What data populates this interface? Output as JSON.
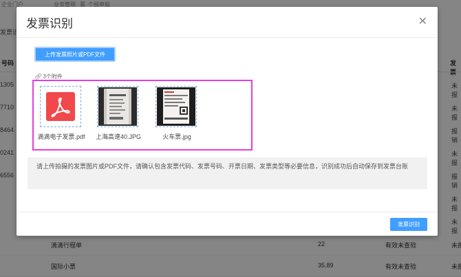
{
  "background": {
    "topnav": [
      "企业门户",
      "业务管理",
      "票",
      "个税申报"
    ],
    "sub_tab": "发票识别",
    "col_left_header": "号码",
    "col_right_header": "发票",
    "left_codes": [
      "1305",
      "7710",
      "8464",
      "0241",
      "6556"
    ],
    "right_statuses": [
      "未报",
      "未报",
      "报销",
      "未报",
      "报销",
      "未报",
      "未报",
      "未报"
    ],
    "rows": [
      {
        "name": "滴滴行程单",
        "amount": "22",
        "status": "有效未查验",
        "right": "未报"
      },
      {
        "name": "国际小票",
        "amount": "35.89",
        "status": "有效未查验",
        "right": "未报"
      }
    ]
  },
  "dialog": {
    "title": "发票识别",
    "close_icon": "close-icon",
    "upload_button": "上传发票照片或PDF文件",
    "attachment_count": "3个附件",
    "files": [
      {
        "name": "滴滴电子发票.pdf",
        "icon": "pdf-icon"
      },
      {
        "name": "上海高速40.JPG",
        "icon": "receipt-photo-thumbnail"
      },
      {
        "name": "火车票.jpg",
        "icon": "train-ticket-thumbnail"
      }
    ],
    "notice": "请上传拍摄的发票图片或PDF文件，请确认包含发票代码、发票号码、开票日期、发票类型等必要信息，识别成功后自动保存到发票台账",
    "recognize_button": "发票识别"
  },
  "colors": {
    "primary": "#409eff",
    "highlight": "#e23ee0",
    "pdf_red": "#f0484b"
  }
}
